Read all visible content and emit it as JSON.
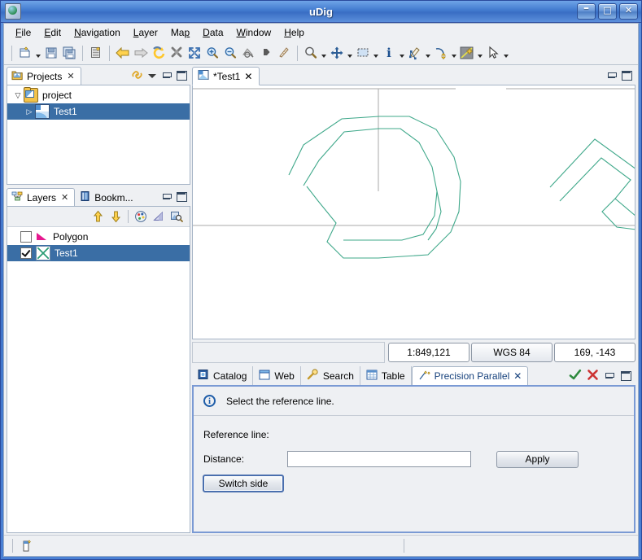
{
  "window": {
    "title": "uDig",
    "icon": "globe-icon",
    "buttons": {
      "minimize": "–",
      "maximize": "□",
      "close": "✕"
    }
  },
  "menubar": {
    "items": [
      {
        "label": "File",
        "mnemonic": "F"
      },
      {
        "label": "Edit",
        "mnemonic": "E"
      },
      {
        "label": "Navigation",
        "mnemonic": "N"
      },
      {
        "label": "Layer",
        "mnemonic": "L"
      },
      {
        "label": "Map",
        "mnemonic": "M"
      },
      {
        "label": "Data",
        "mnemonic": "D"
      },
      {
        "label": "Window",
        "mnemonic": "W"
      },
      {
        "label": "Help",
        "mnemonic": "H"
      }
    ]
  },
  "toolbar": {
    "groups": [
      {
        "items": [
          {
            "icon": "new-map-icon",
            "caret": true
          },
          {
            "icon": "save-icon",
            "caret": false
          },
          {
            "icon": "save-all-icon",
            "caret": false
          }
        ]
      },
      {
        "items": [
          {
            "icon": "print-icon",
            "caret": false
          }
        ]
      },
      {
        "items": [
          {
            "icon": "back-arrow-icon",
            "caret": false
          },
          {
            "icon": "forward-arrow-icon",
            "caret": false
          },
          {
            "icon": "refresh-icon",
            "caret": false
          },
          {
            "icon": "stop-icon",
            "caret": false
          },
          {
            "icon": "zoom-extent-icon",
            "caret": false
          },
          {
            "icon": "zoom-in-icon",
            "caret": false
          },
          {
            "icon": "zoom-out-icon",
            "caret": false
          },
          {
            "icon": "zoom-layer-icon",
            "caret": false
          },
          {
            "icon": "pan-right-icon",
            "caret": false
          },
          {
            "icon": "measure-icon",
            "caret": false
          }
        ]
      },
      {
        "items": [
          {
            "icon": "zoom-tool-icon",
            "caret": true
          },
          {
            "icon": "pan-tool-icon",
            "caret": true
          },
          {
            "icon": "selection-tool-icon",
            "caret": true
          },
          {
            "icon": "info-tool-icon",
            "caret": true
          },
          {
            "icon": "edit-geometry-icon",
            "caret": true
          },
          {
            "icon": "edit-curve-icon",
            "caret": true
          },
          {
            "icon": "add-feature-icon",
            "caret": true
          },
          {
            "icon": "arrow-select-icon",
            "caret": true
          }
        ]
      }
    ]
  },
  "projects_view": {
    "tab": {
      "label": "Projects",
      "icon": "projects-icon",
      "close": "✕"
    },
    "tools": [
      {
        "icon": "link-icon"
      },
      {
        "icon": "view-menu-icon"
      },
      {
        "icon": "minimize-icon"
      },
      {
        "icon": "maximize-icon"
      }
    ],
    "tree": [
      {
        "label": "project",
        "icon": "project-folder-icon",
        "twisty": "▽",
        "indent": 0,
        "selected": false
      },
      {
        "label": "Test1",
        "icon": "map-icon",
        "twisty": "▷",
        "indent": 1,
        "selected": true
      }
    ]
  },
  "layers_view": {
    "tabs": [
      {
        "label": "Layers",
        "icon": "layers-icon",
        "close": "✕",
        "active": true
      },
      {
        "label": "Bookm...",
        "icon": "bookmarks-icon",
        "active": false
      }
    ],
    "tools": [
      {
        "icon": "minimize-icon"
      },
      {
        "icon": "maximize-icon"
      }
    ],
    "toolbar": [
      {
        "icon": "move-up-icon"
      },
      {
        "icon": "move-down-icon"
      },
      {
        "icon": "style-palette-icon"
      },
      {
        "icon": "transparency-icon"
      },
      {
        "icon": "zoom-to-layer-icon"
      }
    ],
    "layers": [
      {
        "label": "Polygon",
        "checked": false,
        "icon": "polygon-layer-icon",
        "selected": false
      },
      {
        "label": "Test1",
        "checked": true,
        "icon": "line-layer-icon",
        "selected": true
      }
    ]
  },
  "editor": {
    "tab": {
      "label": "*Test1",
      "icon": "map-icon",
      "close": "✕"
    },
    "tools": [
      {
        "icon": "minimize-icon"
      },
      {
        "icon": "maximize-icon"
      }
    ],
    "status": {
      "scale": "1:849,121",
      "crs": "WGS 84",
      "coordinates": "169, -143"
    }
  },
  "bottom_panel": {
    "tabs": [
      {
        "label": "Catalog",
        "icon": "catalog-icon",
        "active": false
      },
      {
        "label": "Web",
        "icon": "web-icon",
        "active": false
      },
      {
        "label": "Search",
        "icon": "search-icon",
        "active": false
      },
      {
        "label": "Table",
        "icon": "table-icon",
        "active": false
      },
      {
        "label": "Precision Parallel",
        "icon": "precision-parallel-icon",
        "active": true,
        "close": "✕"
      }
    ],
    "tools": [
      {
        "icon": "accept-check-icon"
      },
      {
        "icon": "cancel-x-icon"
      },
      {
        "icon": "minimize-icon"
      },
      {
        "icon": "maximize-icon"
      }
    ],
    "message": "Select the reference line.",
    "message_icon": "info-icon",
    "form": {
      "reference_line_label": "Reference line:",
      "distance_label": "Distance:",
      "distance_value": "",
      "distance_placeholder": "",
      "apply_label": "Apply",
      "switch_side_label": "Switch side"
    }
  },
  "statusbar": {
    "icon": "edit-mode-icon",
    "text": ""
  },
  "map_graphics": {
    "stroke_color": "#3fa88a",
    "guide_color": "#aaaaaa",
    "background": "#ffffff",
    "description": "Teal polyline features with grey guide lines (vertical and horizontal rulers)"
  }
}
